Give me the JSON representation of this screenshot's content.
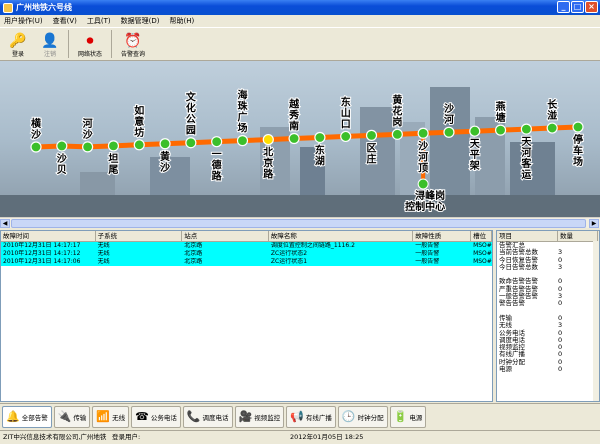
{
  "window": {
    "title": "广州地铁六号线"
  },
  "menu": [
    "用户操作(U)",
    "查看(V)",
    "工具(T)",
    "数据管理(D)",
    "帮助(H)"
  ],
  "toolbar": [
    {
      "label": "登录",
      "icon": "key-icon",
      "glyph": "🔑"
    },
    {
      "label": "注销",
      "icon": "user-icon",
      "glyph": "👤"
    },
    {
      "label": "网络状态",
      "icon": "record-icon",
      "glyph": "⏺"
    },
    {
      "label": "告警查询",
      "icon": "alarm-icon",
      "glyph": "⏰"
    }
  ],
  "colors": {
    "line": "#ff6a00",
    "station": "#3bbf2a",
    "current": "#ffe000",
    "row": "#00ffff"
  },
  "stations": [
    {
      "name": "横沙",
      "pos": "up"
    },
    {
      "name": "沙贝",
      "pos": "down"
    },
    {
      "name": "河沙",
      "pos": "up"
    },
    {
      "name": "坦尾",
      "pos": "down"
    },
    {
      "name": "如意坊",
      "pos": "up"
    },
    {
      "name": "黄沙",
      "pos": "down"
    },
    {
      "name": "文化公园",
      "pos": "up"
    },
    {
      "name": "一德路",
      "pos": "down"
    },
    {
      "name": "海珠广场",
      "pos": "up"
    },
    {
      "name": "北京路",
      "pos": "down",
      "current": true
    },
    {
      "name": "越秀南",
      "pos": "up"
    },
    {
      "name": "东湖",
      "pos": "down"
    },
    {
      "name": "东山口",
      "pos": "up"
    },
    {
      "name": "区庄",
      "pos": "down"
    },
    {
      "name": "黄花岗",
      "pos": "up"
    },
    {
      "name": "沙河顶",
      "pos": "down"
    },
    {
      "name": "沙河",
      "pos": "up"
    },
    {
      "name": "天平架",
      "pos": "down"
    },
    {
      "name": "燕塘",
      "pos": "up"
    },
    {
      "name": "天河客运",
      "pos": "down"
    },
    {
      "name": "长湴",
      "pos": "up"
    },
    {
      "name": "停车场",
      "pos": "down"
    }
  ],
  "branch": {
    "name": "浔峰岗控制中心"
  },
  "alarm_table": {
    "headers": [
      "故障时间",
      "子系统",
      "站点",
      "故障名称",
      "故障性质",
      "槽位"
    ],
    "rows": [
      [
        "2010年12月31日 14:17:17",
        "无线",
        "北京路",
        "调度位置控制之间链路_1116.2",
        "一般告警",
        "MSO#"
      ],
      [
        "2010年12月31日 14:17:12",
        "无线",
        "北京路",
        "ZC运行状态2",
        "一般告警",
        "MSO#"
      ],
      [
        "2010年12月31日 14:17:06",
        "无线",
        "北京路",
        "ZC运行状态1",
        "一般告警",
        "MSO#"
      ]
    ]
  },
  "summary": {
    "headers": [
      "项目",
      "数量"
    ],
    "rows": [
      [
        "告警汇总",
        ""
      ],
      [
        "当前告警总数",
        "3"
      ],
      [
        "今日恢复告警",
        "0"
      ],
      [
        "今日告警总数",
        "3"
      ],
      [
        "",
        ""
      ],
      [
        "致命告警告警",
        "0"
      ],
      [
        "严重告警告警",
        "0"
      ],
      [
        "一般告警告警",
        "3"
      ],
      [
        "警告告警",
        "0"
      ],
      [
        "",
        ""
      ],
      [
        "传输",
        "0"
      ],
      [
        "无线",
        "3"
      ],
      [
        "公务电话",
        "0"
      ],
      [
        "调度电话",
        "0"
      ],
      [
        "视频监控",
        "0"
      ],
      [
        "有线广播",
        "0"
      ],
      [
        "时钟分配",
        "0"
      ],
      [
        "电源",
        "0"
      ]
    ]
  },
  "tabs": [
    {
      "label": "全部告警",
      "glyph": "🔔",
      "icon": "all-alarms-icon"
    },
    {
      "label": "传输",
      "glyph": "🔌",
      "icon": "transmission-icon"
    },
    {
      "label": "无线",
      "glyph": "📶",
      "icon": "wireless-icon"
    },
    {
      "label": "公务电话",
      "glyph": "☎",
      "icon": "phone-icon"
    },
    {
      "label": "调度电话",
      "glyph": "📞",
      "icon": "dispatch-phone-icon"
    },
    {
      "label": "视频监控",
      "glyph": "🎥",
      "icon": "camera-icon"
    },
    {
      "label": "有线广播",
      "glyph": "📢",
      "icon": "broadcast-icon"
    },
    {
      "label": "时钟分配",
      "glyph": "🕒",
      "icon": "clock-icon"
    },
    {
      "label": "电源",
      "glyph": "🔋",
      "icon": "power-icon"
    }
  ],
  "status": {
    "company": "ZIT中兴信息技术有限公司,广州地铁",
    "user_label": "登录用户:",
    "datetime": "2012年01月05日 18:25"
  }
}
